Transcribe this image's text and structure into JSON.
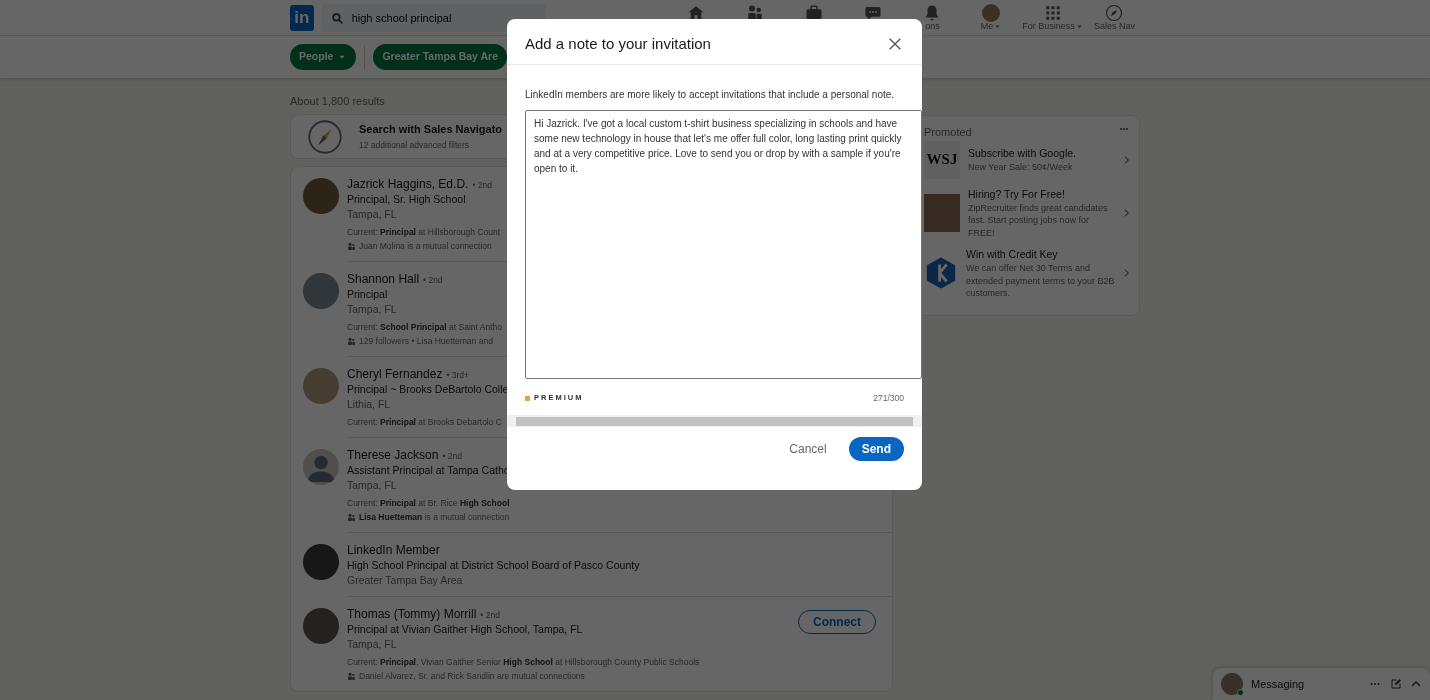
{
  "nav": {
    "logo": "in",
    "search": {
      "value": "high school principal"
    },
    "items": [
      {
        "kind": "home"
      },
      {
        "kind": "network"
      },
      {
        "kind": "jobs"
      },
      {
        "kind": "messaging"
      },
      {
        "kind": "bell",
        "label": "ons"
      },
      {
        "kind": "avatar",
        "label": "Me",
        "dropdown": true
      },
      {
        "kind": "grid",
        "label": "For Business",
        "dropdown": true
      },
      {
        "kind": "compass",
        "label": "Sales Nav"
      }
    ]
  },
  "filters": [
    {
      "label": "People",
      "dropdown": true
    },
    {
      "label": "Greater Tampa Bay Are",
      "dropdown": false
    }
  ],
  "results_count": "About 1,800 results",
  "sales_navigator": {
    "title": "Search with Sales Navigato",
    "subtitle": "12 additional advanced filters"
  },
  "results": [
    {
      "kind": "photo",
      "name": "Jazrick Haggins, Ed.D.",
      "degree": "• 2nd",
      "headline": "Principal, Sr. High School",
      "location": "Tampa, FL",
      "current": "Current: **Principal** at Hillsborough Count",
      "mutual": "Juan Molina is a mutual connection"
    },
    {
      "kind": "photo",
      "name": "Shannon Hall",
      "degree": "• 2nd",
      "headline": "Principal",
      "location": "Tampa, FL",
      "current": "Current: **School Principal** at Saint Antho",
      "mutual": "129 followers • Lisa Huetteman and"
    },
    {
      "kind": "photo",
      "name": "Cheryl Fernandez",
      "degree": "• 3rd+",
      "headline": "Principal ~ Brooks DeBartolo Colle",
      "location": "Lithia, FL",
      "current": "Current: **Principal** at Brooks Debartolo C"
    },
    {
      "kind": "silhouette",
      "name": "Therese Jackson",
      "degree": "• 2nd",
      "headline": "Assistant Principal at Tampa Catho",
      "location": "Tampa, FL",
      "current": "Current: **Principal** at Br. Rice **High School**",
      "mutual": "**Lisa Huetteman** is a mutual connection"
    },
    {
      "kind": "photo",
      "name": "LinkedIn Member",
      "headline": "High School Principal at District School Board of Pasco County",
      "location": "Greater Tampa Bay Area"
    },
    {
      "kind": "photo",
      "name": "Thomas (Tommy) Morrill",
      "degree": "• 2nd",
      "headline": "Principal at Vivian Gaither High School, Tampa, FL",
      "location": "Tampa, FL",
      "current": "Current: **Principal**, Vivian Gaither Senior **High School** at Hillsborough County Public Schools",
      "mutual": "Daniel Alvarez, Sr. and Rick Sandlin are mutual connections",
      "action": "Connect"
    }
  ],
  "ads": {
    "heading": "Promoted",
    "items": [
      {
        "kind": "wordmark",
        "logo_text": "WSJ",
        "title": "Subscribe with Google.",
        "text": "New Year Sale: 50¢/Week"
      },
      {
        "kind": "photo",
        "title": "Hiring? Try For Free!",
        "text": "ZipRecruiter finds great candidates fast. Start posting jobs now for FREE!"
      },
      {
        "kind": "hexagon",
        "title": "Win with Credit Key",
        "text": "We can offer Net 30 Terms and extended payment terms to your B2B customers."
      }
    ]
  },
  "messaging": {
    "label": "Messaging",
    "online": true
  },
  "modal": {
    "title": "Add a note to your invitation",
    "intro": "LinkedIn members are more likely to accept invitations that include a personal note.",
    "message": "Hi Jazrick. I've got a local custom t-shirt business specializing in schools and have some new technology in house that let's me offer full color, long lasting print quickly and at a very competitive price. Love to send you or drop by with a sample if you're open to it.",
    "premium": "PREMIUM",
    "counter": "271/300",
    "cancel": "Cancel",
    "send": "Send"
  }
}
